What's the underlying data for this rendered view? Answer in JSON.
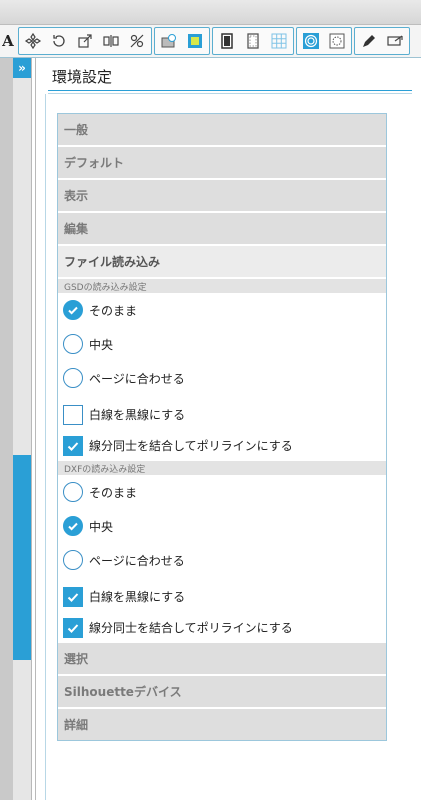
{
  "toolbar": {
    "letter": "A",
    "icons": [
      "replicate-icon",
      "rotate-icon",
      "resize-icon",
      "align-icon",
      "transform-icon",
      "media-icon",
      "fill-icon",
      "page-icon",
      "page-outline-icon",
      "grid-icon",
      "trace-icon",
      "offset-icon",
      "pen-icon",
      "send-icon"
    ]
  },
  "panel": {
    "title": "環境設定"
  },
  "sections_top": [
    "一般",
    "デフォルト",
    "表示",
    "編集"
  ],
  "active_section": "ファイル読み込み",
  "gsd": {
    "heading": "GSDの読み込み設定",
    "options": [
      "そのまま",
      "中央",
      "ページに合わせる"
    ],
    "selected": "そのまま",
    "checks": [
      {
        "label": "白線を黒線にする",
        "checked": false
      },
      {
        "label": "線分同士を結合してポリラインにする",
        "checked": true
      }
    ]
  },
  "dxf": {
    "heading": "DXFの読み込み設定",
    "options": [
      "そのまま",
      "中央",
      "ページに合わせる"
    ],
    "selected": "中央",
    "checks": [
      {
        "label": "白線を黒線にする",
        "checked": true
      },
      {
        "label": "線分同士を結合してポリラインにする",
        "checked": true
      }
    ]
  },
  "sections_bottom": [
    "選択",
    "Silhouetteデバイス",
    "詳細"
  ],
  "colors": {
    "accent": "#2a9fd6",
    "section_bg": "#dedede"
  }
}
